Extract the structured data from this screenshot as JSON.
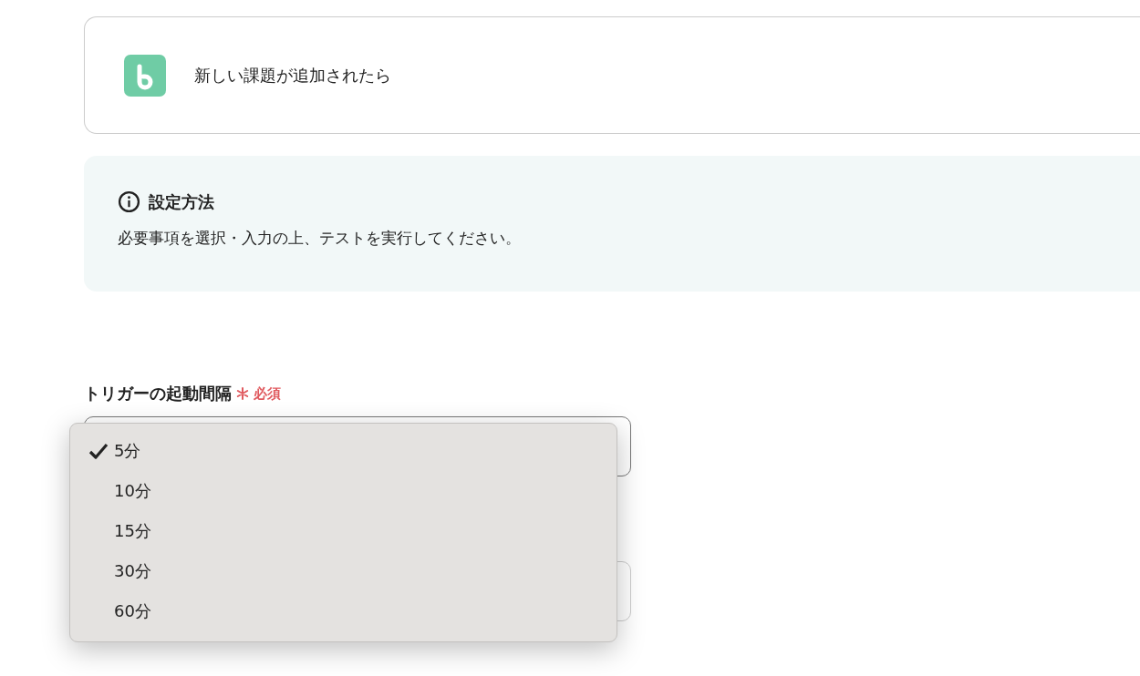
{
  "trigger": {
    "title": "新しい課題が追加されたら"
  },
  "info": {
    "title": "設定方法",
    "text": "必要事項を選択・入力の上、テストを実行してください。"
  },
  "interval_field": {
    "label": "トリガーの起動間隔",
    "required": true,
    "required_label": "必須",
    "dropdown_open": true,
    "options": [
      {
        "label": "5分",
        "selected": true
      },
      {
        "label": "10分",
        "selected": false
      },
      {
        "label": "15分",
        "selected": false
      },
      {
        "label": "30分",
        "selected": false
      },
      {
        "label": "60分",
        "selected": false
      }
    ]
  }
}
